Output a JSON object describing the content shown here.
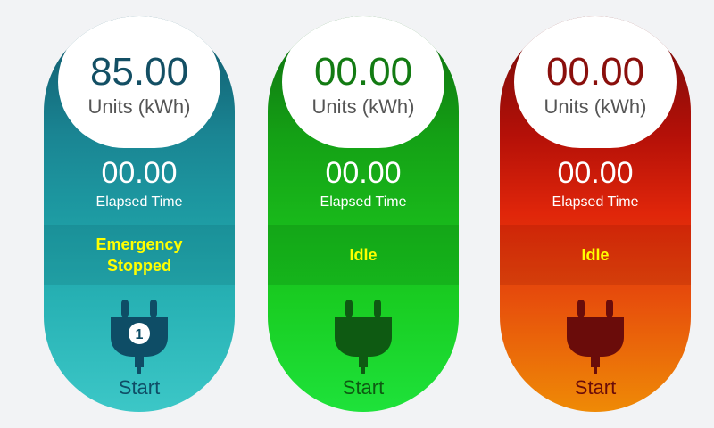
{
  "connectors": [
    {
      "units_value": "85.00",
      "units_label": "Units (kWh)",
      "elapsed_value": "00.00",
      "elapsed_label": "Elapsed Time",
      "status": "Emergency\nStopped",
      "badge_number": "1",
      "start_label": "Start",
      "icon": "plug-icon",
      "icon_color": "#0e4d66"
    },
    {
      "units_value": "00.00",
      "units_label": "Units (kWh)",
      "elapsed_value": "00.00",
      "elapsed_label": "Elapsed Time",
      "status": "Idle",
      "start_label": "Start",
      "icon": "plug-icon",
      "icon_color": "#0e5a12"
    },
    {
      "units_value": "00.00",
      "units_label": "Units (kWh)",
      "elapsed_value": "00.00",
      "elapsed_label": "Elapsed Time",
      "status": "Idle",
      "start_label": "Start",
      "icon": "plug-icon",
      "icon_color": "#6a0c0a"
    }
  ],
  "colors": {
    "status_text": "#ffff00",
    "background": "#f2f3f5"
  }
}
